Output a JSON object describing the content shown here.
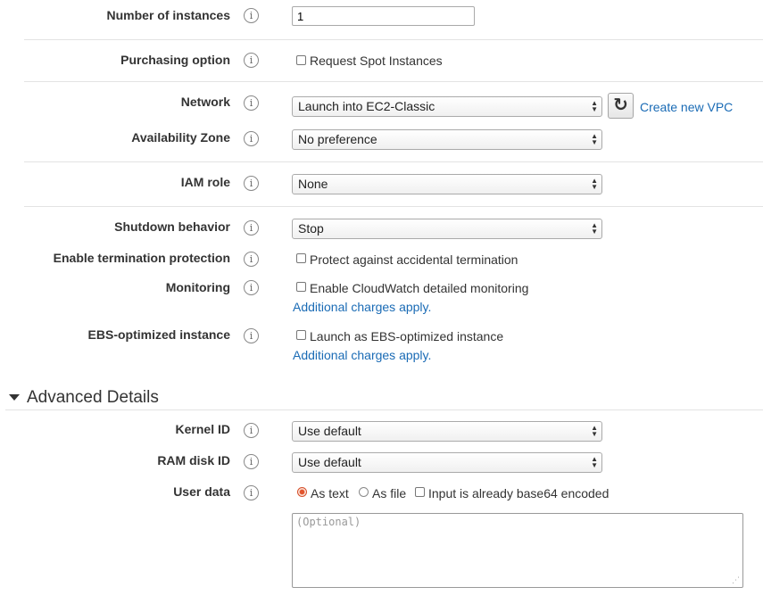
{
  "instances": {
    "label": "Number of instances",
    "value": "1"
  },
  "purchasing": {
    "label": "Purchasing option",
    "checkbox_label": "Request Spot Instances"
  },
  "network": {
    "label": "Network",
    "value": "Launch into EC2-Classic",
    "refresh_icon": "refresh-icon",
    "create_link": "Create new VPC"
  },
  "az": {
    "label": "Availability Zone",
    "value": "No preference"
  },
  "iam": {
    "label": "IAM role",
    "value": "None"
  },
  "shutdown": {
    "label": "Shutdown behavior",
    "value": "Stop"
  },
  "termination": {
    "label": "Enable termination protection",
    "checkbox_label": "Protect against accidental termination"
  },
  "monitoring": {
    "label": "Monitoring",
    "checkbox_label": "Enable CloudWatch detailed monitoring",
    "charges_link": "Additional charges apply."
  },
  "ebs": {
    "label": "EBS-optimized instance",
    "checkbox_label": "Launch as EBS-optimized instance",
    "charges_link": "Additional charges apply."
  },
  "advanced": {
    "title": "Advanced Details"
  },
  "kernel": {
    "label": "Kernel ID",
    "value": "Use default"
  },
  "ramdisk": {
    "label": "RAM disk ID",
    "value": "Use default"
  },
  "userdata": {
    "label": "User data",
    "radio_text": "As text",
    "radio_file": "As file",
    "base64_label": "Input is already base64 encoded",
    "placeholder": "(Optional)"
  },
  "info_glyph": "i",
  "colors": {
    "link": "#1a6bb5",
    "radio_selected": "#e2552e",
    "label": "#333333"
  }
}
